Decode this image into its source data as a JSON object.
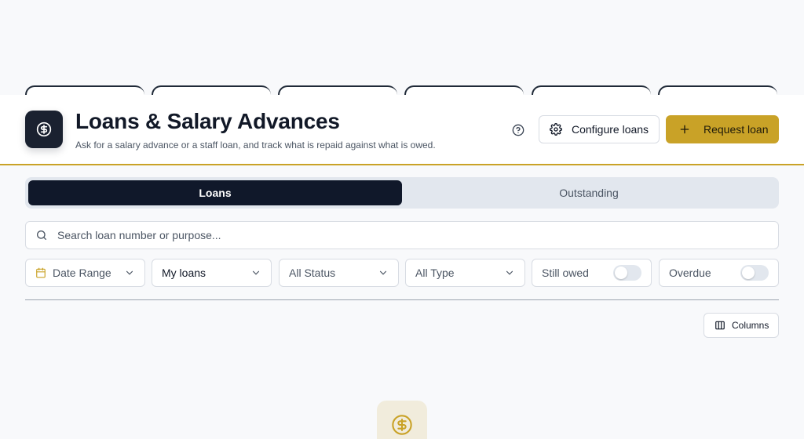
{
  "header": {
    "title": "Loans & Salary Advances",
    "subtitle": "Ask for a salary advance or a staff loan, and track what is repaid against what is owed.",
    "configure_label": "Configure loans",
    "request_label": "Request loan",
    "logo_icon": "dollar-circle-icon",
    "help_icon": "help-circle-icon"
  },
  "tabs": [
    {
      "label": "Loans",
      "active": true
    },
    {
      "label": "Outstanding",
      "active": false
    }
  ],
  "search": {
    "placeholder": "Search loan number or purpose..."
  },
  "filters": {
    "date_range": "Date Range",
    "scope": "My loans",
    "status": "All Status",
    "type": "All Type",
    "still_owed": "Still owed",
    "overdue": "Overdue"
  },
  "table": {
    "columns_label": "Columns"
  },
  "colors": {
    "accent": "#c9a227",
    "navy": "#10182a",
    "tab_bg": "#e2e7ee"
  }
}
